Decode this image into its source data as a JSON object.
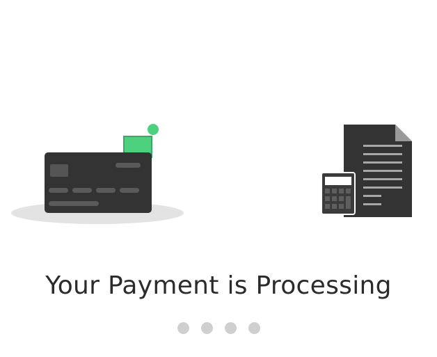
{
  "processing": {
    "title": "Your Payment is Processing",
    "dot_count": 4,
    "active_dot": null
  },
  "colors": {
    "card": "#333333",
    "card_detail": "#5a5a5a",
    "accent_green": "#4dd17f",
    "shadow": "#e3e3e3",
    "dot": "#cfcfcf",
    "text": "#2b2b2b"
  },
  "icons": {
    "card": "credit-card-icon",
    "receipt": "invoice-document-icon",
    "calculator": "calculator-icon"
  }
}
